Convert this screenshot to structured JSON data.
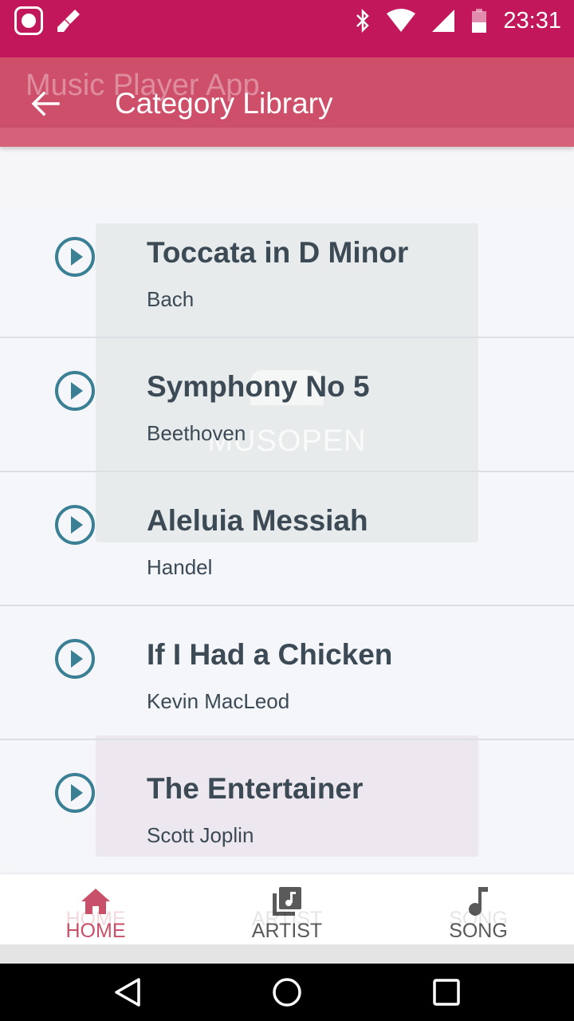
{
  "status_bar": {
    "time": "23:31",
    "icons": [
      "mi-icon",
      "broom-icon",
      "bluetooth-icon",
      "wifi-icon",
      "signal-icon",
      "battery-icon"
    ]
  },
  "app_bar": {
    "ghost_title": "Music Player App",
    "title": "Category Library",
    "back_icon": "arrow-back-icon"
  },
  "watermark": {
    "text": "MUSOPEN"
  },
  "songs": [
    {
      "title": "Toccata in D Minor",
      "artist": "Bach"
    },
    {
      "title": "Symphony No 5",
      "artist": "Beethoven"
    },
    {
      "title": "Aleluia Messiah",
      "artist": "Handel"
    },
    {
      "title": "If I Had a Chicken",
      "artist": "Kevin MacLeod"
    },
    {
      "title": "The Entertainer",
      "artist": "Scott Joplin"
    }
  ],
  "bottom_nav": {
    "items": [
      {
        "label": "HOME",
        "ghost": "HOME",
        "icon": "home-icon",
        "active": true
      },
      {
        "label": "ARTIST",
        "ghost": "ARTIST",
        "icon": "library-music-icon",
        "active": false
      },
      {
        "label": "SONG",
        "ghost": "SONG",
        "icon": "music-note-icon",
        "active": false
      }
    ]
  },
  "colors": {
    "status_bar": "#c2185b",
    "app_bar": "#cd4f6a",
    "play_icon": "#3a7f94",
    "active_nav": "#c85068",
    "text": "#3c4a55"
  }
}
